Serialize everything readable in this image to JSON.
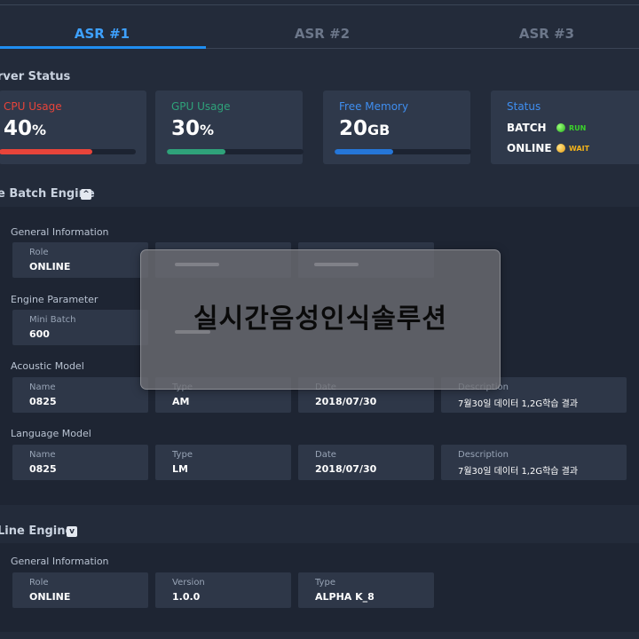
{
  "tabs": [
    {
      "label": "ASR #1",
      "active": true
    },
    {
      "label": "ASR #2",
      "active": false
    },
    {
      "label": "ASR #3",
      "active": false
    }
  ],
  "server_status": {
    "title": "rver Status",
    "cpu": {
      "label": "CPU Usage",
      "value": "40",
      "unit": "%",
      "percent": 40,
      "color": "#e8443a"
    },
    "gpu": {
      "label": "GPU Usage",
      "value": "30",
      "unit": "%",
      "percent": 30,
      "color": "#2fa27a"
    },
    "memory": {
      "label": "Free Memory",
      "value": "20",
      "unit": "GB",
      "percent": 30,
      "color": "#2576d8"
    },
    "status": {
      "label": "Status",
      "batch": {
        "name": "BATCH",
        "state": "RUN",
        "color": "#3bd32a"
      },
      "online": {
        "name": "ONLINE",
        "state": "WAIT",
        "color": "#f2b21a"
      }
    }
  },
  "batch_engine": {
    "title": "e Batch Engine",
    "toggle": "^",
    "general": {
      "title": "General Information",
      "role_label": "Role",
      "role_value": "ONLINE"
    },
    "param": {
      "title": "Engine Parameter",
      "mini_label": "Mini Batch",
      "mini_value": "600"
    },
    "acoustic": {
      "title": "Acoustic Model",
      "name_label": "Name",
      "name_value": "0825",
      "type_label": "Type",
      "type_value": "AM",
      "date_label": "Date",
      "date_value": "2018/07/30",
      "desc_label": "Description",
      "desc_value": "7월30일 데이터 1,2G학습 결과"
    },
    "language": {
      "title": "Language Model",
      "name_label": "Name",
      "name_value": "0825",
      "type_label": "Type",
      "type_value": "LM",
      "date_label": "Date",
      "date_value": "2018/07/30",
      "desc_label": "Description",
      "desc_value": "7월30일 데이터 1,2G학습 결과"
    }
  },
  "online_engine": {
    "title": "Line Engine",
    "toggle": "v",
    "general": {
      "title": "General Information",
      "role_label": "Role",
      "role_value": "ONLINE",
      "version_label": "Version",
      "version_value": "1.0.0",
      "type_label": "Type",
      "type_value": "ALPHA K_8"
    }
  },
  "overlay": {
    "text": "실시간음성인식솔루션"
  }
}
